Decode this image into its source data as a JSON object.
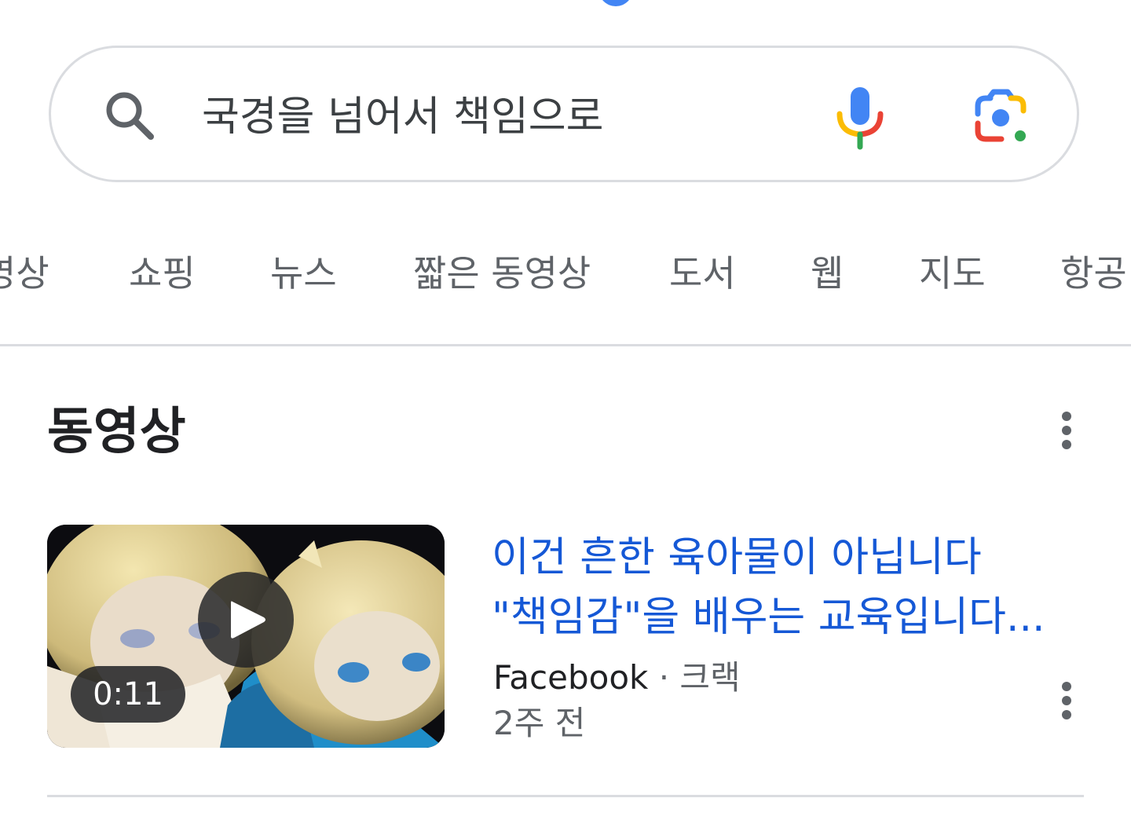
{
  "search": {
    "query": "국경을 넘어서 책임으로"
  },
  "tabs": [
    {
      "label": "영상"
    },
    {
      "label": "쇼핑"
    },
    {
      "label": "뉴스"
    },
    {
      "label": "짧은 동영상"
    },
    {
      "label": "도서"
    },
    {
      "label": "웹"
    },
    {
      "label": "지도"
    },
    {
      "label": "항공"
    }
  ],
  "videos_section": {
    "title": "동영상",
    "items": [
      {
        "title_line1": "이건 흔한 육아물이 아닙니다",
        "title_line2": "\"책임감\"을 배우는 교육입니다...",
        "source": "Facebook",
        "separator": " · ",
        "channel": "크랙",
        "date": "2주 전",
        "duration": "0:11"
      }
    ]
  },
  "icons": {
    "search": "search-icon",
    "mic": "microphone-icon",
    "lens": "camera-lens-icon",
    "more": "more-vert-icon",
    "play": "play-icon"
  },
  "colors": {
    "link": "#1558d6",
    "google_blue": "#4285f4",
    "google_red": "#ea4335",
    "google_yellow": "#fbbc04",
    "google_green": "#34a853"
  }
}
